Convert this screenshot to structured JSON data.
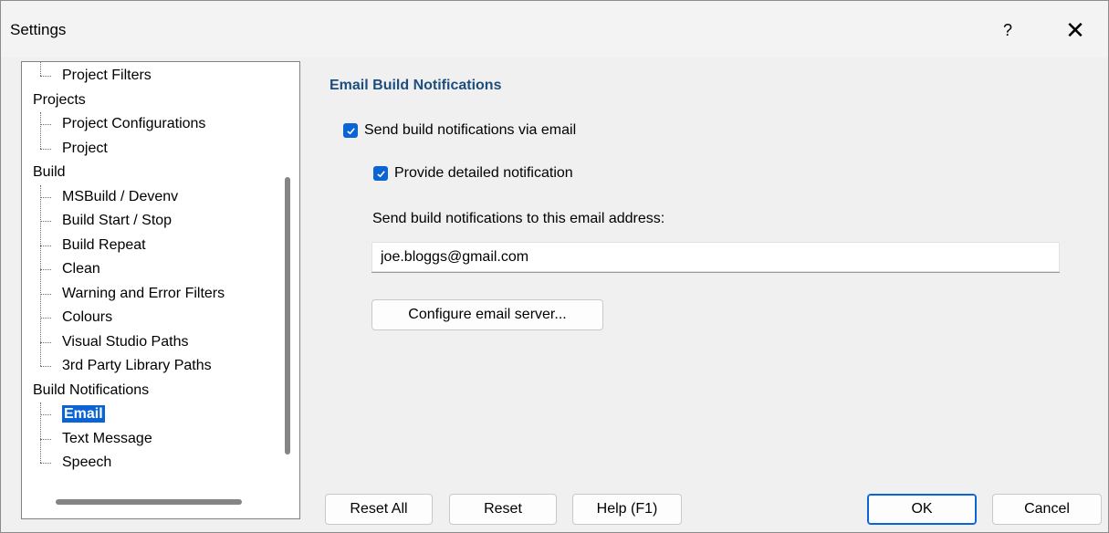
{
  "window": {
    "title": "Settings",
    "help_label": "?",
    "close_label": "✕"
  },
  "tree": {
    "items": [
      {
        "label": "Project Filters",
        "level": "child"
      },
      {
        "label": "Projects",
        "level": "parent"
      },
      {
        "label": "Project Configurations",
        "level": "child"
      },
      {
        "label": "Project",
        "level": "child"
      },
      {
        "label": "Build",
        "level": "parent"
      },
      {
        "label": "MSBuild / Devenv",
        "level": "child"
      },
      {
        "label": "Build Start / Stop",
        "level": "child"
      },
      {
        "label": "Build Repeat",
        "level": "child"
      },
      {
        "label": "Clean",
        "level": "child"
      },
      {
        "label": "Warning and Error Filters",
        "level": "child"
      },
      {
        "label": "Colours",
        "level": "child"
      },
      {
        "label": "Visual Studio Paths",
        "level": "child"
      },
      {
        "label": "3rd Party Library Paths",
        "level": "child"
      },
      {
        "label": "Build Notifications",
        "level": "parent"
      },
      {
        "label": "Email",
        "level": "child",
        "selected": true
      },
      {
        "label": "Text Message",
        "level": "child"
      },
      {
        "label": "Speech",
        "level": "child"
      }
    ]
  },
  "panel": {
    "title": "Email Build Notifications",
    "send_via_email": {
      "label": "Send build notifications via email",
      "checked": true
    },
    "detailed": {
      "label": "Provide detailed notification",
      "checked": true
    },
    "address_label": "Send build notifications to this email address:",
    "email_value": "joe.bloggs@gmail.com",
    "configure_button": "Configure email server..."
  },
  "footer": {
    "reset_all": "Reset All",
    "reset": "Reset",
    "help": "Help (F1)",
    "ok": "OK",
    "cancel": "Cancel"
  },
  "colors": {
    "accent": "#0a64d4",
    "section_title": "#1e4e7e"
  }
}
